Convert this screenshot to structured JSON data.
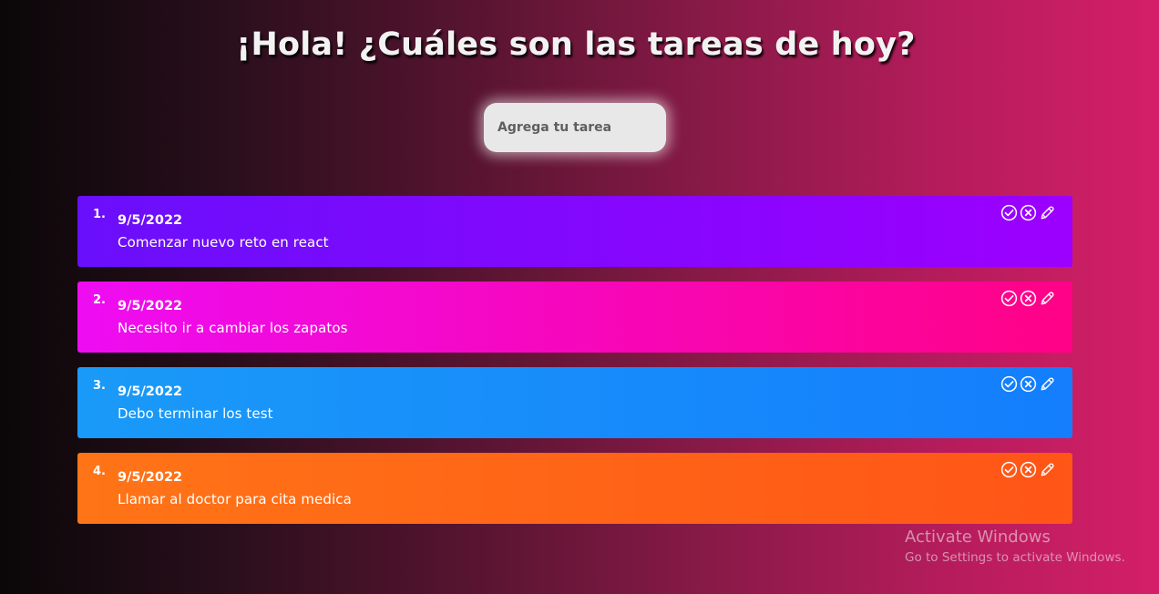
{
  "header": {
    "title": "¡Hola! ¿Cuáles son las tareas de hoy?"
  },
  "input": {
    "placeholder": "Agrega tu tarea"
  },
  "tasks": [
    {
      "number": "1.",
      "date": "9/5/2022",
      "text": "Comenzar nuevo reto en react",
      "color_start": "#6a0ffb",
      "color_end": "#9c00ff"
    },
    {
      "number": "2.",
      "date": "9/5/2022",
      "text": "Necesito ir a cambiar los zapatos",
      "color_start": "#ee0cf2",
      "color_end": "#ff0286"
    },
    {
      "number": "3.",
      "date": "9/5/2022",
      "text": "Debo terminar los test",
      "color_start": "#1a9af8",
      "color_end": "#147efd"
    },
    {
      "number": "4.",
      "date": "9/5/2022",
      "text": "Llamar al doctor para cita medica",
      "color_start": "#ff7417",
      "color_end": "#ff5517"
    }
  ],
  "task_actions": [
    "check-circle-icon",
    "x-circle-icon",
    "edit-pencil-icon"
  ],
  "watermark": {
    "title": "Activate Windows",
    "subtitle": "Go to Settings to activate Windows."
  }
}
